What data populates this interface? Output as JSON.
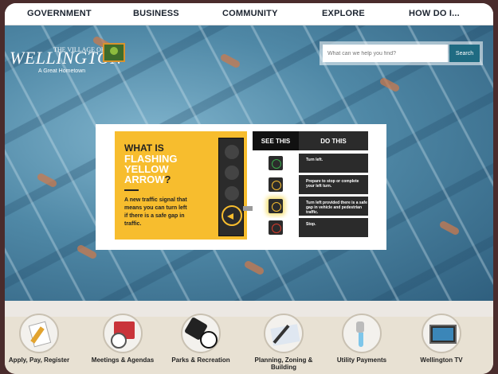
{
  "nav": {
    "items": [
      "GOVERNMENT",
      "BUSINESS",
      "COMMUNITY",
      "EXPLORE",
      "HOW DO I..."
    ]
  },
  "logo": {
    "prefix": "THE VILLAGE OF",
    "name": "WELLINGTON",
    "tagline": "A Great Hometown"
  },
  "search": {
    "placeholder": "What can we help you find?",
    "button": "Search"
  },
  "slide": {
    "what_is": "WHAT IS",
    "flashing": "FLASHING",
    "yellow": "YELLOW",
    "arrow": "ARROW",
    "qmark": "?",
    "description": "A new traffic signal that means you can turn left if there is a safe gap in traffic.",
    "see_this": "SEE THIS",
    "do_this": "DO THIS",
    "rows": [
      {
        "text": "Turn left.",
        "color": "#3aa84a"
      },
      {
        "text": "Prepare to stop or complete your left turn.",
        "color": "#f7bd2e"
      },
      {
        "text": "Turn left provided there is a safe gap in vehicle and pedestrian traffic.",
        "color": "#f7bd2e"
      },
      {
        "text": "Stop.",
        "color": "#d83b2c"
      }
    ]
  },
  "quicklinks": [
    {
      "label": "Apply, Pay, Register",
      "icon": "clipboard-pencil-icon"
    },
    {
      "label": "Meetings & Agendas",
      "icon": "calendar-clock-icon"
    },
    {
      "label": "Parks & Recreation",
      "icon": "sports-ball-icon"
    },
    {
      "label": "Planning, Zoning & Building",
      "icon": "blueprint-icon"
    },
    {
      "label": "Utility Payments",
      "icon": "faucet-icon"
    },
    {
      "label": "Wellington TV",
      "icon": "tv-icon"
    }
  ]
}
